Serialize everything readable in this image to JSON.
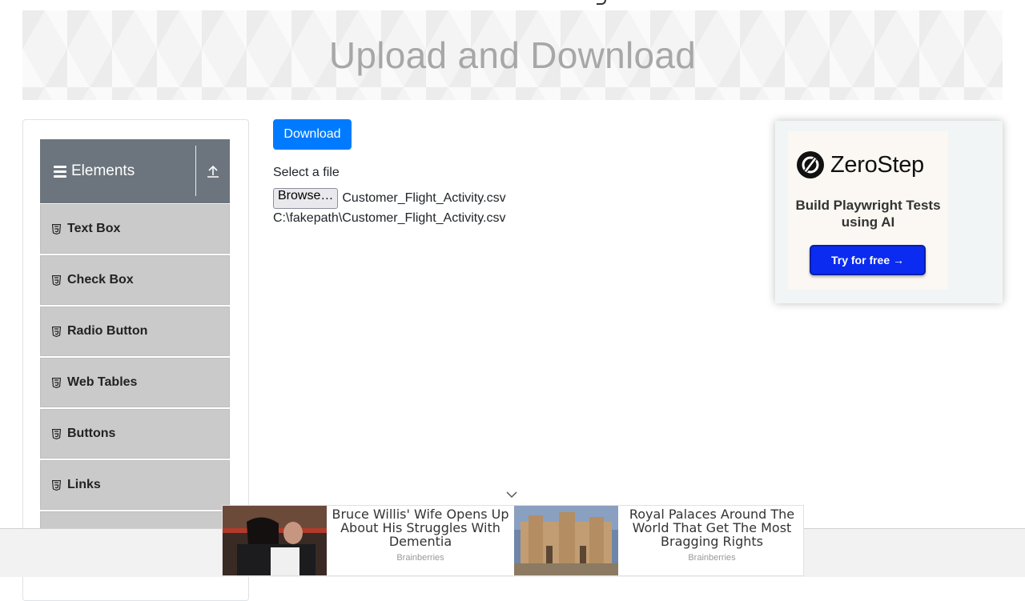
{
  "header": {
    "title": "Upload and Download"
  },
  "sidebar": {
    "group": {
      "title": "Elements"
    },
    "items": [
      {
        "label": "Text Box"
      },
      {
        "label": "Check Box"
      },
      {
        "label": "Radio Button"
      },
      {
        "label": "Web Tables"
      },
      {
        "label": "Buttons"
      },
      {
        "label": "Links"
      }
    ]
  },
  "main": {
    "download_label": "Download",
    "select_label": "Select a file",
    "browse_label": "Browse…",
    "file_name": "Customer_Flight_Activity.csv",
    "uploaded_path": "C:\\fakepath\\Customer_Flight_Activity.csv"
  },
  "ad": {
    "brand": "ZeroStep",
    "tagline": "Build Playwright Tests using AI",
    "cta": "Try for free →"
  },
  "bottom_ads": [
    {
      "headline": "Bruce Willis' Wife Opens Up About His Struggles With Dementia",
      "source": "Brainberries"
    },
    {
      "headline": "Royal Palaces Around The World That Get The Most Bragging Rights",
      "source": "Brainberries"
    }
  ],
  "colors": {
    "primary": "#007bff",
    "sidebar_header": "#6c757d",
    "menu_item": "#cacaca",
    "cta": "#0b2bf0"
  }
}
